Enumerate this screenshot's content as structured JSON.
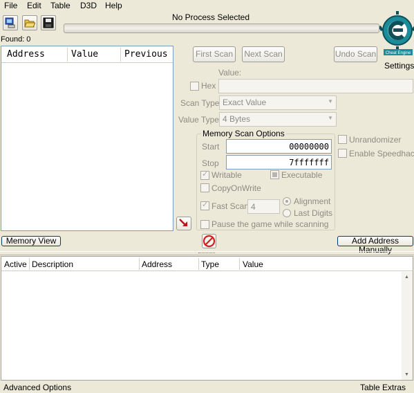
{
  "menu": [
    "File",
    "Edit",
    "Table",
    "D3D",
    "Help"
  ],
  "toolbar": {
    "open_process_icon": "computer-icon",
    "open_file_icon": "folder-open-icon",
    "save_icon": "floppy-disk-icon"
  },
  "process_title": "No Process Selected",
  "logo_text": "Cheat Engine",
  "settings_label": "Settings",
  "found_label": "Found: 0",
  "result_columns": [
    "Address",
    "Value",
    "Previous"
  ],
  "scan_buttons": {
    "first_scan": "First Scan",
    "next_scan": "Next Scan",
    "undo_scan": "Undo Scan"
  },
  "value_label": "Value:",
  "hex_label": "Hex",
  "scan_type": {
    "label": "Scan Type",
    "selected": "Exact Value"
  },
  "value_type": {
    "label": "Value Type",
    "selected": "4 Bytes"
  },
  "memory_scan_options": {
    "title": "Memory Scan Options",
    "start_label": "Start",
    "start_value": "00000000",
    "stop_label": "Stop",
    "stop_value": "7fffffff",
    "writable_label": "Writable",
    "executable_label": "Executable",
    "copyonwrite_label": "CopyOnWrite",
    "fast_scan_label": "Fast Scan",
    "fast_scan_value": "4",
    "alignment_label": "Alignment",
    "last_digits_label": "Last Digits",
    "pause_label": "Pause the game while scanning"
  },
  "unrandomizer_label": "Unrandomizer",
  "speedhack_label": "Enable Speedhack",
  "memory_view_button": "Memory View",
  "add_address_button": "Add Address Manually",
  "address_columns": [
    "Active",
    "Description",
    "Address",
    "Type",
    "Value"
  ],
  "advanced_options": "Advanced Options",
  "table_extras": "Table Extras",
  "colors": {
    "window_bg": "#ece9d8",
    "logo_teal": "#1a8c9a",
    "stop_red": "#d21f1f"
  }
}
